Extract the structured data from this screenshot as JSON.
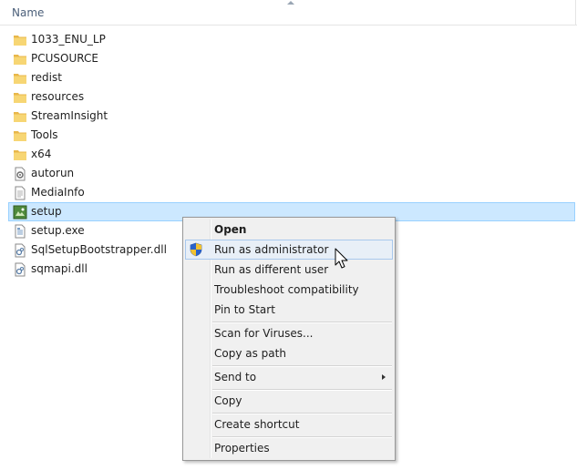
{
  "header": {
    "name_column": "Name"
  },
  "files": [
    {
      "name": "1033_ENU_LP",
      "icon": "folder-icon"
    },
    {
      "name": "PCUSOURCE",
      "icon": "folder-icon"
    },
    {
      "name": "redist",
      "icon": "folder-icon"
    },
    {
      "name": "resources",
      "icon": "folder-icon"
    },
    {
      "name": "StreamInsight",
      "icon": "folder-icon"
    },
    {
      "name": "Tools",
      "icon": "folder-icon"
    },
    {
      "name": "x64",
      "icon": "folder-icon"
    },
    {
      "name": "autorun",
      "icon": "autorun-file-icon"
    },
    {
      "name": "MediaInfo",
      "icon": "text-file-icon"
    },
    {
      "name": "setup",
      "icon": "setup-app-icon",
      "selected": true
    },
    {
      "name": "setup.exe",
      "icon": "exe-config-icon"
    },
    {
      "name": "SqlSetupBootstrapper.dll",
      "icon": "dll-file-icon"
    },
    {
      "name": "sqmapi.dll",
      "icon": "dll-file-icon"
    }
  ],
  "context_menu": {
    "open": "Open",
    "run_as_admin": "Run as administrator",
    "run_as_different_user": "Run as different user",
    "troubleshoot": "Troubleshoot compatibility",
    "pin_to_start": "Pin to Start",
    "scan_viruses": "Scan for Viruses...",
    "copy_as_path": "Copy as path",
    "send_to": "Send to",
    "copy": "Copy",
    "create_shortcut": "Create shortcut",
    "properties": "Properties"
  },
  "colors": {
    "selection_bg": "#cce8ff",
    "selection_border": "#99d1ff",
    "menu_bg": "#f0f0f0",
    "menu_hover_bg": "#e8eff7",
    "menu_hover_border": "#a8c8ed",
    "folder_yellow": "#e8b74a"
  }
}
